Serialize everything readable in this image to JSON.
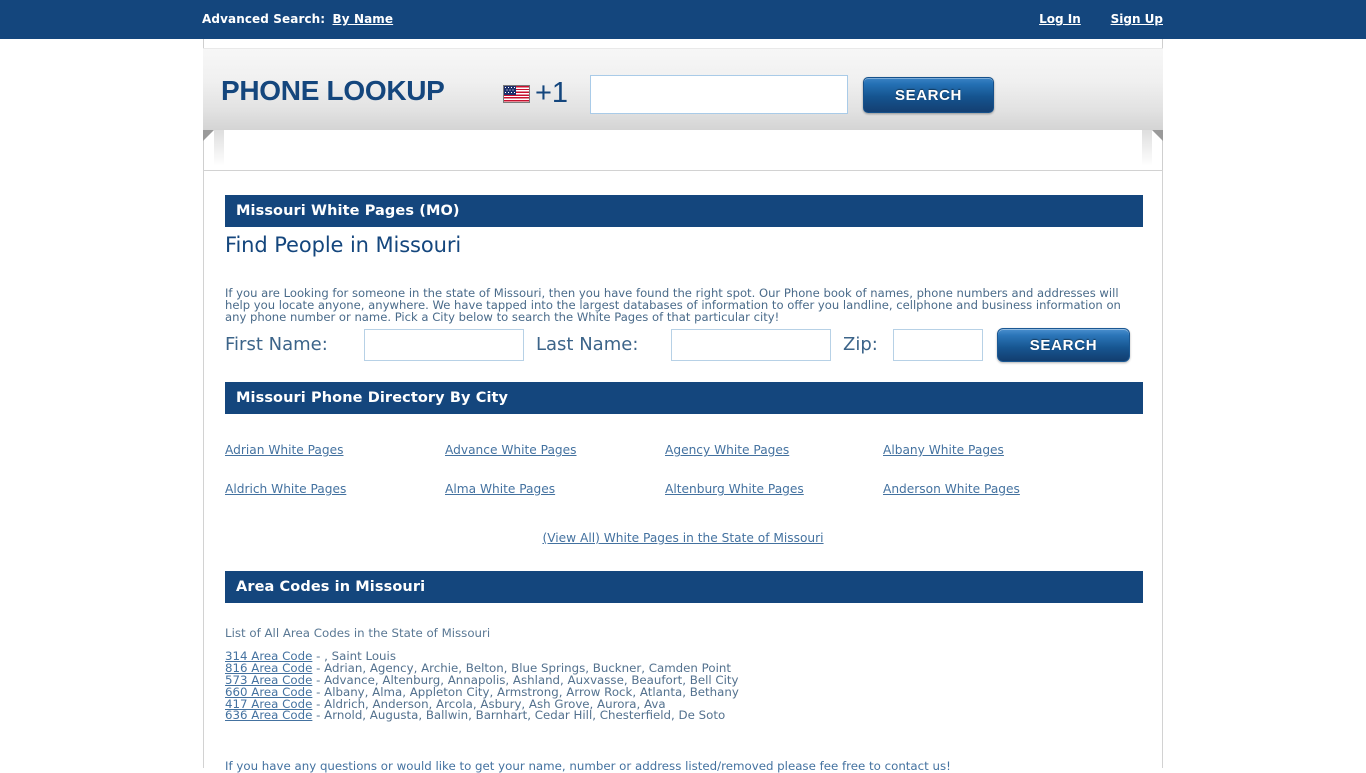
{
  "topbar": {
    "advanced_search_label": "Advanced Search:",
    "by_name_label": "By Name",
    "log_in_label": "Log In",
    "sign_up_label": "Sign Up"
  },
  "lookup": {
    "title": "PHONE LOOKUP",
    "flag_icon": "us-flag-icon",
    "country_code": "+1",
    "phone_value": "",
    "phone_placeholder": "",
    "search_label": "SEARCH"
  },
  "state_section": {
    "header": "Missouri White Pages (MO)",
    "heading": "Find People in Missouri",
    "intro": "If you are Looking for someone in the state of Missouri, then you have found the right spot. Our Phone book of names, phone numbers and addresses will help you locate anyone, anywhere. We have tapped into the largest databases of information to offer you landline, cellphone and business information on any phone number or name. Pick a City below to search the White Pages of that particular city!",
    "form": {
      "first_name_label": "First Name:",
      "first_name_value": "",
      "last_name_label": "Last Name:",
      "last_name_value": "",
      "zip_label": "Zip:",
      "zip_value": "",
      "search_label": "SEARCH"
    }
  },
  "city_section": {
    "header": "Missouri Phone Directory By City",
    "cities": [
      "Adrian White Pages",
      "Advance White Pages",
      "Agency White Pages",
      "Albany White Pages",
      "Aldrich White Pages",
      "Alma White Pages",
      "Altenburg White Pages",
      "Anderson White Pages"
    ],
    "view_all_label": "(View All) White Pages in the State of Missouri"
  },
  "area_section": {
    "header": "Area Codes in Missouri",
    "note": "List of All Area Codes in the State of Missouri",
    "rows": [
      {
        "code": "314 Area Code",
        "cities": " - , Saint Louis"
      },
      {
        "code": "816 Area Code",
        "cities": " - Adrian, Agency, Archie, Belton, Blue Springs, Buckner, Camden Point"
      },
      {
        "code": "573 Area Code",
        "cities": " - Advance, Altenburg, Annapolis, Ashland, Auxvasse, Beaufort, Bell City"
      },
      {
        "code": "660 Area Code",
        "cities": " - Albany, Alma, Appleton City, Armstrong, Arrow Rock, Atlanta, Bethany"
      },
      {
        "code": "417 Area Code",
        "cities": " - Aldrich, Anderson, Arcola, Asbury, Ash Grove, Aurora, Ava"
      },
      {
        "code": "636 Area Code",
        "cities": " - Arnold, Augusta, Ballwin, Barnhart, Cedar Hill, Chesterfield, De Soto"
      }
    ]
  },
  "footer": {
    "contact_text": "If you have any questions or would like to get your name, number or address listed/removed please fee free to contact us!"
  },
  "colors": {
    "brand_blue": "#14467d",
    "link_blue": "#4472a0",
    "body_text": "#53718e"
  }
}
